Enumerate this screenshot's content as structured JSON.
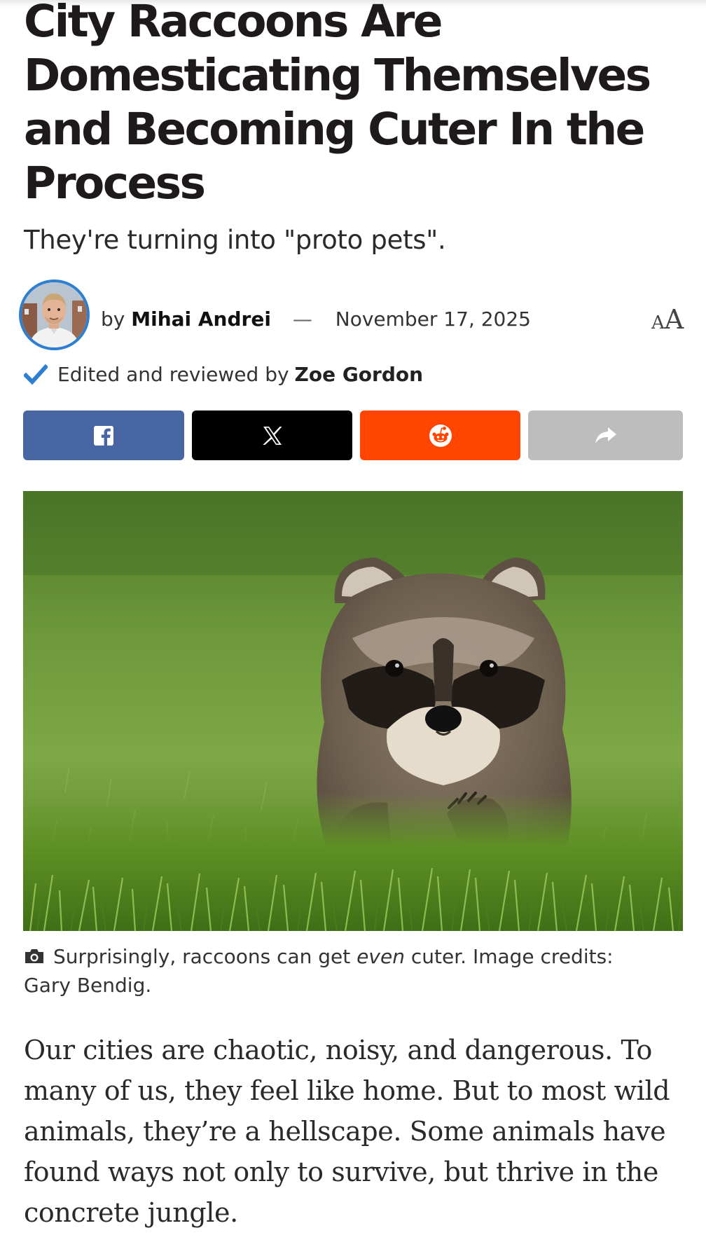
{
  "article": {
    "title": "City Raccoons Are Domesticating Themselves and Becoming Cuter In the Process",
    "subtitle": "They're turning into \"proto pets\"."
  },
  "byline": {
    "prefix": "by",
    "author": "Mihai Andrei",
    "separator": "—",
    "date": "November 17, 2025",
    "font_size_control": {
      "small": "A",
      "big": "A",
      "icon": "text-size-icon"
    }
  },
  "review": {
    "icon": "checkmark-icon",
    "label": "Edited and reviewed by",
    "reviewer": "Zoe Gordon"
  },
  "share_buttons": [
    {
      "network": "facebook",
      "icon": "facebook-icon",
      "color": "#4866a4"
    },
    {
      "network": "x",
      "icon": "x-icon",
      "color": "#000000"
    },
    {
      "network": "reddit",
      "icon": "reddit-icon",
      "color": "#ff4500"
    },
    {
      "network": "share",
      "icon": "share-arrow-icon",
      "color": "#bdbdbd"
    }
  ],
  "image": {
    "subject": "raccoon kit on grass",
    "caption_pre": "Surprisingly, raccoons can get ",
    "caption_em": "even",
    "caption_post": " cuter. Image credits: Gary Bendig.",
    "caption_icon": "camera-icon"
  },
  "body": {
    "paragraph_1": "Our cities are chaotic, noisy, and dangerous. To many of us, they feel like home. But to most wild animals, they’re a hellscape. Some animals have found ways not only to survive, but thrive in the concrete jungle."
  },
  "colors": {
    "accent_blue": "#2e7fd1",
    "title_text": "#1e1a1b"
  }
}
